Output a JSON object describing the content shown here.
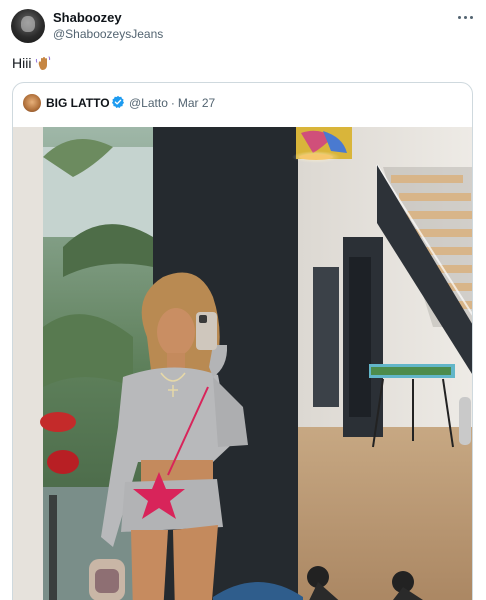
{
  "author": {
    "display_name": "Shaboozey",
    "handle": "@ShaboozeysJeans",
    "avatar_icon": "profile-photo-icon"
  },
  "tweet": {
    "text": "Hiii",
    "emoji_icon": "waving-hand-icon"
  },
  "more_icon": "more-options-icon",
  "quoted_tweet": {
    "display_name": "BIG LATTO",
    "verified": true,
    "handle": "@Latto",
    "separator": "·",
    "date": "Mar 27",
    "verified_icon": "verified-badge-icon",
    "verified_color": "#1d9bf0",
    "image_description_icon": "mirror-selfie-photo"
  },
  "colors": {
    "text_primary": "#0f1419",
    "text_secondary": "#536471",
    "border": "#cfd9de"
  }
}
